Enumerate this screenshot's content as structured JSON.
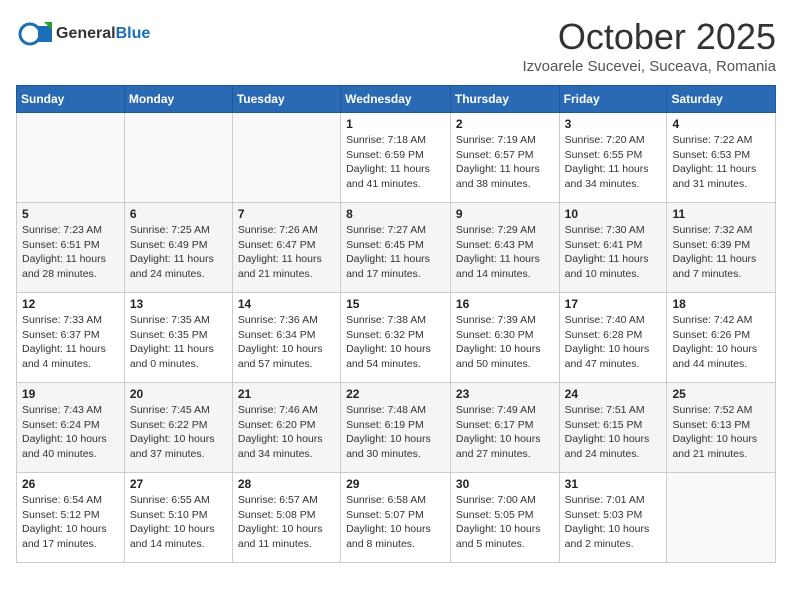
{
  "header": {
    "logo_line1": "General",
    "logo_line2": "Blue",
    "month": "October 2025",
    "location": "Izvoarele Sucevei, Suceava, Romania"
  },
  "weekdays": [
    "Sunday",
    "Monday",
    "Tuesday",
    "Wednesday",
    "Thursday",
    "Friday",
    "Saturday"
  ],
  "weeks": [
    [
      {
        "day": "",
        "info": ""
      },
      {
        "day": "",
        "info": ""
      },
      {
        "day": "",
        "info": ""
      },
      {
        "day": "1",
        "info": "Sunrise: 7:18 AM\nSunset: 6:59 PM\nDaylight: 11 hours and 41 minutes."
      },
      {
        "day": "2",
        "info": "Sunrise: 7:19 AM\nSunset: 6:57 PM\nDaylight: 11 hours and 38 minutes."
      },
      {
        "day": "3",
        "info": "Sunrise: 7:20 AM\nSunset: 6:55 PM\nDaylight: 11 hours and 34 minutes."
      },
      {
        "day": "4",
        "info": "Sunrise: 7:22 AM\nSunset: 6:53 PM\nDaylight: 11 hours and 31 minutes."
      }
    ],
    [
      {
        "day": "5",
        "info": "Sunrise: 7:23 AM\nSunset: 6:51 PM\nDaylight: 11 hours and 28 minutes."
      },
      {
        "day": "6",
        "info": "Sunrise: 7:25 AM\nSunset: 6:49 PM\nDaylight: 11 hours and 24 minutes."
      },
      {
        "day": "7",
        "info": "Sunrise: 7:26 AM\nSunset: 6:47 PM\nDaylight: 11 hours and 21 minutes."
      },
      {
        "day": "8",
        "info": "Sunrise: 7:27 AM\nSunset: 6:45 PM\nDaylight: 11 hours and 17 minutes."
      },
      {
        "day": "9",
        "info": "Sunrise: 7:29 AM\nSunset: 6:43 PM\nDaylight: 11 hours and 14 minutes."
      },
      {
        "day": "10",
        "info": "Sunrise: 7:30 AM\nSunset: 6:41 PM\nDaylight: 11 hours and 10 minutes."
      },
      {
        "day": "11",
        "info": "Sunrise: 7:32 AM\nSunset: 6:39 PM\nDaylight: 11 hours and 7 minutes."
      }
    ],
    [
      {
        "day": "12",
        "info": "Sunrise: 7:33 AM\nSunset: 6:37 PM\nDaylight: 11 hours and 4 minutes."
      },
      {
        "day": "13",
        "info": "Sunrise: 7:35 AM\nSunset: 6:35 PM\nDaylight: 11 hours and 0 minutes."
      },
      {
        "day": "14",
        "info": "Sunrise: 7:36 AM\nSunset: 6:34 PM\nDaylight: 10 hours and 57 minutes."
      },
      {
        "day": "15",
        "info": "Sunrise: 7:38 AM\nSunset: 6:32 PM\nDaylight: 10 hours and 54 minutes."
      },
      {
        "day": "16",
        "info": "Sunrise: 7:39 AM\nSunset: 6:30 PM\nDaylight: 10 hours and 50 minutes."
      },
      {
        "day": "17",
        "info": "Sunrise: 7:40 AM\nSunset: 6:28 PM\nDaylight: 10 hours and 47 minutes."
      },
      {
        "day": "18",
        "info": "Sunrise: 7:42 AM\nSunset: 6:26 PM\nDaylight: 10 hours and 44 minutes."
      }
    ],
    [
      {
        "day": "19",
        "info": "Sunrise: 7:43 AM\nSunset: 6:24 PM\nDaylight: 10 hours and 40 minutes."
      },
      {
        "day": "20",
        "info": "Sunrise: 7:45 AM\nSunset: 6:22 PM\nDaylight: 10 hours and 37 minutes."
      },
      {
        "day": "21",
        "info": "Sunrise: 7:46 AM\nSunset: 6:20 PM\nDaylight: 10 hours and 34 minutes."
      },
      {
        "day": "22",
        "info": "Sunrise: 7:48 AM\nSunset: 6:19 PM\nDaylight: 10 hours and 30 minutes."
      },
      {
        "day": "23",
        "info": "Sunrise: 7:49 AM\nSunset: 6:17 PM\nDaylight: 10 hours and 27 minutes."
      },
      {
        "day": "24",
        "info": "Sunrise: 7:51 AM\nSunset: 6:15 PM\nDaylight: 10 hours and 24 minutes."
      },
      {
        "day": "25",
        "info": "Sunrise: 7:52 AM\nSunset: 6:13 PM\nDaylight: 10 hours and 21 minutes."
      }
    ],
    [
      {
        "day": "26",
        "info": "Sunrise: 6:54 AM\nSunset: 5:12 PM\nDaylight: 10 hours and 17 minutes."
      },
      {
        "day": "27",
        "info": "Sunrise: 6:55 AM\nSunset: 5:10 PM\nDaylight: 10 hours and 14 minutes."
      },
      {
        "day": "28",
        "info": "Sunrise: 6:57 AM\nSunset: 5:08 PM\nDaylight: 10 hours and 11 minutes."
      },
      {
        "day": "29",
        "info": "Sunrise: 6:58 AM\nSunset: 5:07 PM\nDaylight: 10 hours and 8 minutes."
      },
      {
        "day": "30",
        "info": "Sunrise: 7:00 AM\nSunset: 5:05 PM\nDaylight: 10 hours and 5 minutes."
      },
      {
        "day": "31",
        "info": "Sunrise: 7:01 AM\nSunset: 5:03 PM\nDaylight: 10 hours and 2 minutes."
      },
      {
        "day": "",
        "info": ""
      }
    ]
  ]
}
